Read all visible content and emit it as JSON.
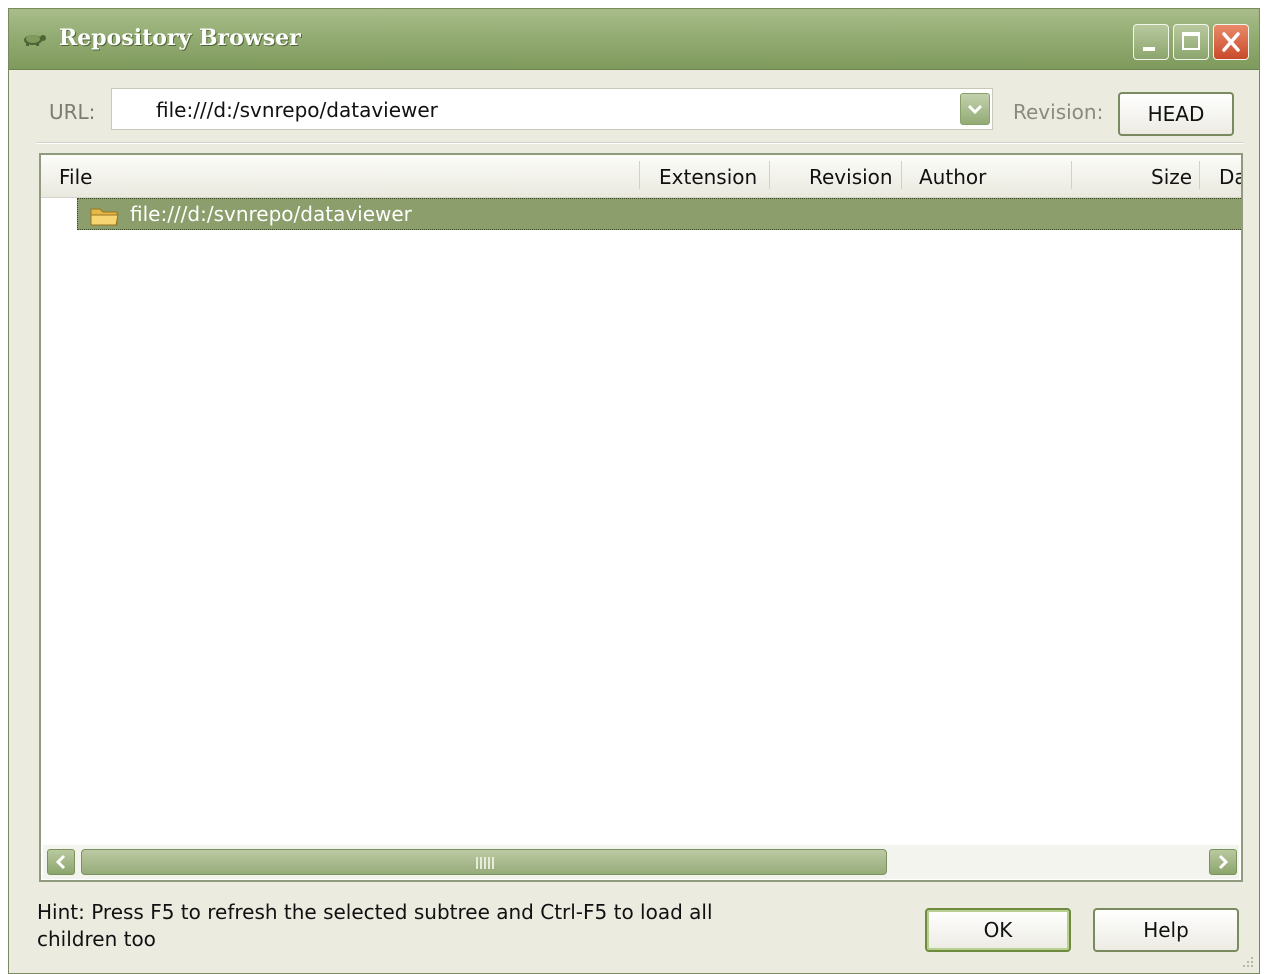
{
  "window": {
    "title": "Repository Browser"
  },
  "toolbar": {
    "url_label": "URL:",
    "url_value": "file:///d:/svnrepo/dataviewer",
    "revision_label": "Revision:",
    "revision_button": "HEAD"
  },
  "list": {
    "columns": [
      "File",
      "Extension",
      "Revision",
      "Author",
      "Size",
      "Da"
    ],
    "rows": [
      {
        "name": "file:///d:/svnrepo/dataviewer",
        "icon": "folder-icon",
        "selected": true
      }
    ]
  },
  "footer": {
    "hint": "Hint: Press F5 to refresh the selected subtree and Ctrl-F5 to load all children too",
    "ok_button": "OK",
    "help_button": "Help"
  },
  "colors": {
    "titlebar": "#93ac73",
    "selection": "#8c9e6c",
    "close_button": "#c9492b"
  }
}
